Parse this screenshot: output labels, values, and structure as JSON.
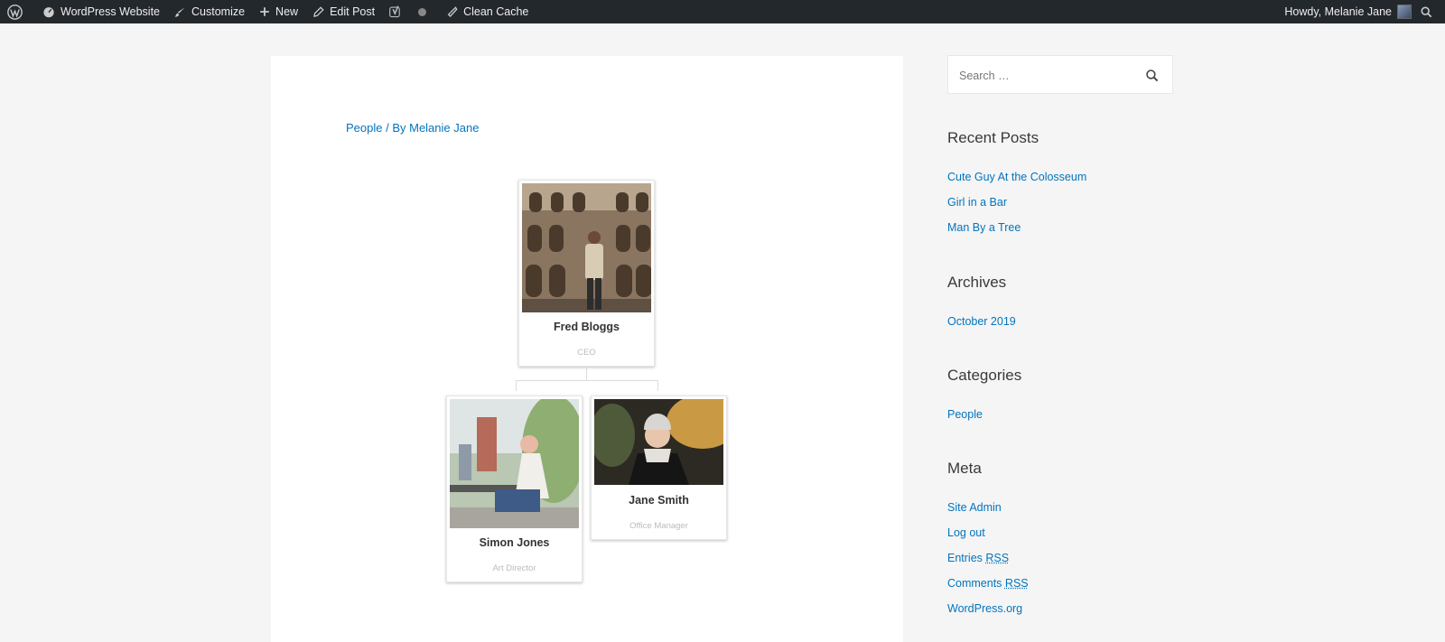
{
  "adminbar": {
    "site_name": "WordPress Website",
    "customize": "Customize",
    "new": "New",
    "edit_post": "Edit Post",
    "clean_cache": "Clean Cache",
    "greeting": "Howdy, Melanie Jane"
  },
  "post": {
    "category": "People",
    "by_prefix": " / By ",
    "author": "Melanie Jane"
  },
  "org_chart": {
    "root": {
      "name": "Fred Bloggs",
      "role": "CEO"
    },
    "children": [
      {
        "name": "Simon Jones",
        "role": "Art Director"
      },
      {
        "name": "Jane Smith",
        "role": "Office Manager"
      }
    ]
  },
  "sidebar": {
    "search_placeholder": "Search …",
    "recent_posts": {
      "title": "Recent Posts",
      "items": [
        "Cute Guy At the Colosseum",
        "Girl in a Bar",
        "Man By a Tree"
      ]
    },
    "archives": {
      "title": "Archives",
      "items": [
        "October 2019"
      ]
    },
    "categories": {
      "title": "Categories",
      "items": [
        "People"
      ]
    },
    "meta": {
      "title": "Meta",
      "site_admin": "Site Admin",
      "log_out": "Log out",
      "entries": "Entries",
      "comments": "Comments",
      "rss": "RSS",
      "wordpress_org": "WordPress.org"
    }
  },
  "colors": {
    "link": "#0274be",
    "adminbar": "#23282d",
    "background": "#f5f5f5"
  }
}
